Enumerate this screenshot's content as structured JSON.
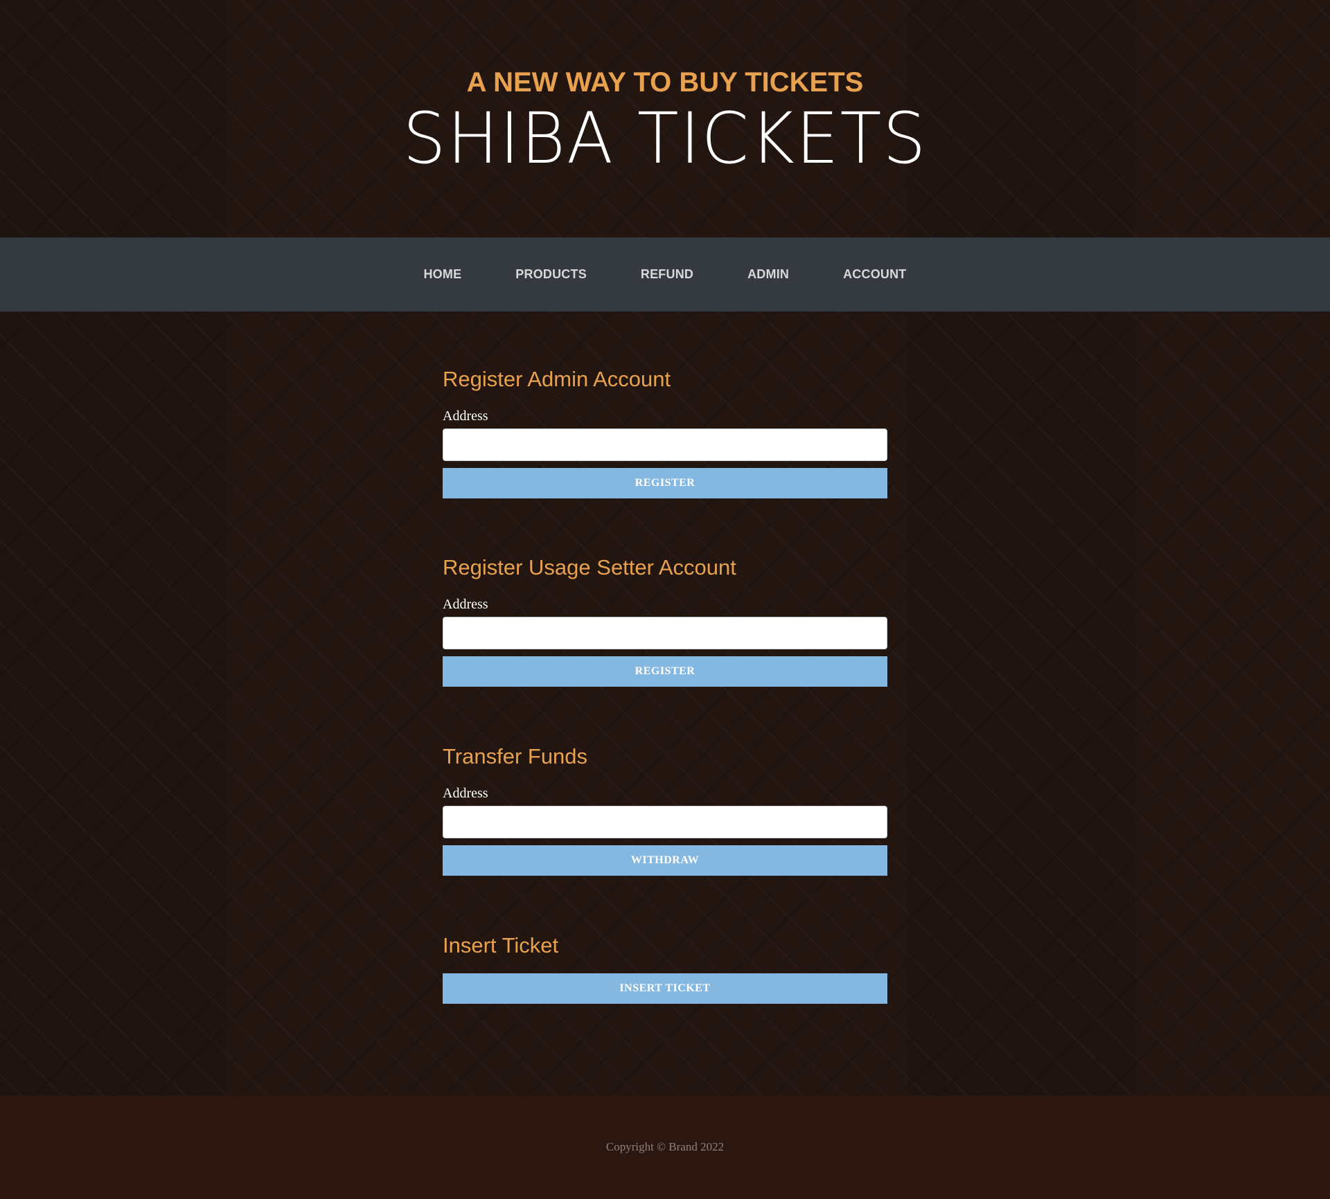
{
  "header": {
    "tagline": "A NEW WAY TO BUY TICKETS",
    "brand": "SHIBA TICKETS"
  },
  "nav": {
    "items": [
      {
        "label": "HOME"
      },
      {
        "label": "PRODUCTS"
      },
      {
        "label": "REFUND"
      },
      {
        "label": "ADMIN"
      },
      {
        "label": "ACCOUNT"
      }
    ]
  },
  "sections": {
    "admin": {
      "title": "Register Admin Account",
      "field_label": "Address",
      "value": "",
      "button": "REGISTER"
    },
    "usage_setter": {
      "title": "Register Usage Setter Account",
      "field_label": "Address",
      "value": "",
      "button": "REGISTER"
    },
    "transfer": {
      "title": "Transfer Funds",
      "field_label": "Address",
      "value": "",
      "button": "WITHDRAW"
    },
    "insert_ticket": {
      "title": "Insert Ticket",
      "button": "INSERT TICKET"
    }
  },
  "footer": {
    "copyright": "Copyright © Brand 2022"
  },
  "colors": {
    "accent": "#e8a14e",
    "navbar": "#353940",
    "button": "#85b8e0",
    "background": "#231611",
    "footer": "#2c1710"
  }
}
